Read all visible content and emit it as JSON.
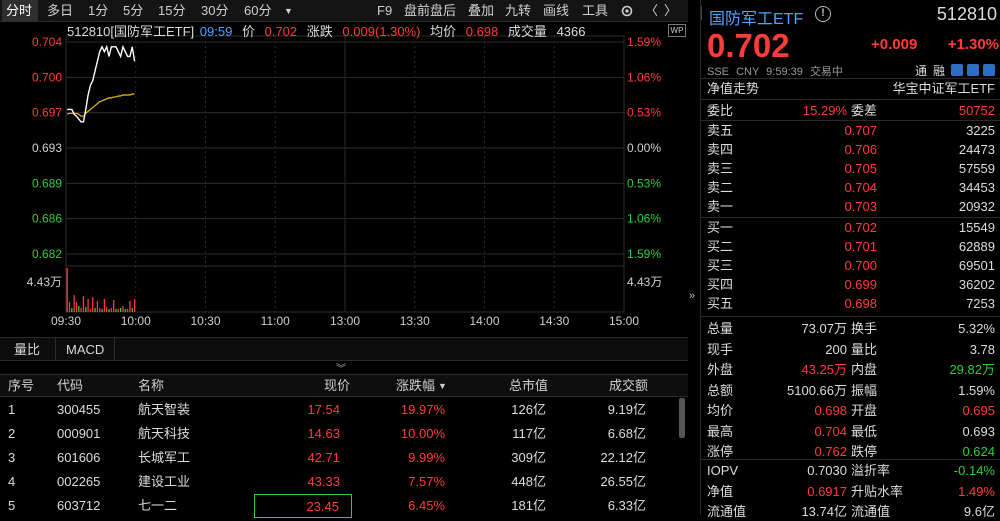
{
  "toolbar": {
    "items": [
      "分时",
      "多日",
      "1分",
      "5分",
      "15分",
      "30分",
      "60分",
      "F9",
      "盘前盘后",
      "叠加",
      "九转",
      "画线",
      "工具"
    ],
    "active": "分时"
  },
  "chart_header": {
    "code_name": "512810[国防军工ETF]",
    "time": "09:59",
    "price_label": "价",
    "price": "0.702",
    "change_label": "涨跌",
    "change": "0.009(1.30%)",
    "avg_label": "均价",
    "avg": "0.698",
    "vol_label": "成交量",
    "vol": "4366"
  },
  "chart_data": {
    "type": "line",
    "y_ticks_left": [
      "0.704",
      "0.700",
      "0.697",
      "0.693",
      "0.689",
      "0.686",
      "0.682"
    ],
    "y_ticks_right": [
      "1.59%",
      "1.06%",
      "0.53%",
      "0.00%",
      "0.53%",
      "1.06%",
      "1.59%"
    ],
    "ylim": [
      0.682,
      0.704
    ],
    "prev_close": 0.693,
    "x_ticks": [
      "09:30",
      "10:00",
      "10:30",
      "11:00",
      "13:00",
      "13:30",
      "14:00",
      "14:30",
      "15:00"
    ],
    "price_series": {
      "values": [
        0.697,
        0.697,
        0.697,
        0.6965,
        0.6963,
        0.696,
        0.6957,
        0.6957,
        0.697,
        0.6985,
        0.6995,
        0.7,
        0.701,
        0.702,
        0.703,
        0.7035,
        0.703,
        0.7035,
        0.7025,
        0.7035,
        0.7035,
        0.7035,
        0.703,
        0.7025,
        0.7035,
        0.703,
        0.7025,
        0.7025,
        0.7035,
        0.702
      ]
    },
    "avg_series": {
      "values": [
        0.6965,
        0.6966,
        0.6966,
        0.6966,
        0.6966,
        0.6965,
        0.6963,
        0.6963,
        0.6966,
        0.6968,
        0.697,
        0.6972,
        0.6974,
        0.6976,
        0.6978,
        0.6979,
        0.698,
        0.6981,
        0.6982,
        0.6982,
        0.6983,
        0.6983,
        0.6984,
        0.6984,
        0.6985,
        0.6985,
        0.6985,
        0.6985,
        0.6986,
        0.6986
      ]
    },
    "volume_label": "4.43万",
    "volume": {
      "values": [
        4.43,
        1.0,
        0.4,
        1.7,
        1.0,
        0.6,
        0.4,
        1.6,
        0.5,
        1.3,
        0.3,
        1.5,
        0.4,
        1.1,
        0.4,
        0.3,
        1.3,
        0.5,
        0.3,
        0.4,
        1.2,
        0.3,
        0.3,
        0.4,
        0.6,
        0.3,
        0.3,
        1.1,
        0.4,
        1.3
      ]
    },
    "volume_up": [
      true,
      true,
      false,
      true,
      true,
      false,
      true,
      true,
      false,
      true,
      true,
      true,
      false,
      true,
      true,
      false,
      true,
      true,
      false,
      true,
      true,
      false,
      true,
      false,
      true,
      false,
      true,
      true,
      false,
      true
    ]
  },
  "indicator_tabs": [
    "量比",
    "MACD"
  ],
  "table": {
    "headers": [
      "序号",
      "代码",
      "名称",
      "现价",
      "涨跌幅",
      "总市值",
      "成交额"
    ],
    "sort_icon": "▼",
    "rows": [
      [
        "1",
        "300455",
        "航天智装",
        "17.54",
        "19.97%",
        "126亿",
        "9.19亿"
      ],
      [
        "2",
        "000901",
        "航天科技",
        "14.63",
        "10.00%",
        "117亿",
        "6.68亿"
      ],
      [
        "3",
        "601606",
        "长城军工",
        "42.71",
        "9.99%",
        "309亿",
        "22.12亿"
      ],
      [
        "4",
        "002265",
        "建设工业",
        "43.33",
        "7.57%",
        "448亿",
        "26.55亿"
      ],
      [
        "5",
        "603712",
        "七一二",
        "23.45",
        "6.45%",
        "181亿",
        "6.33亿"
      ]
    ]
  },
  "quote": {
    "name": "国防军工ETF",
    "code": "512810",
    "price": "0.702",
    "change": "+0.009",
    "pct": "+1.30%",
    "exchange": "SSE",
    "currency": "CNY",
    "time": "9:59:39",
    "status": "交易中",
    "badges": [
      "通",
      "融"
    ],
    "nav_trend": "净值走势",
    "tracking": "华宝中证军工ETF",
    "weibi_label": "委比",
    "weibi": "15.29%",
    "weicha_label": "委差",
    "weicha": "50752"
  },
  "asks": [
    {
      "label": "卖五",
      "price": "0.707",
      "vol": "3225"
    },
    {
      "label": "卖四",
      "price": "0.706",
      "vol": "24473"
    },
    {
      "label": "卖三",
      "price": "0.705",
      "vol": "57559"
    },
    {
      "label": "卖二",
      "price": "0.704",
      "vol": "34453"
    },
    {
      "label": "卖一",
      "price": "0.703",
      "vol": "20932"
    }
  ],
  "bids": [
    {
      "label": "买一",
      "price": "0.702",
      "vol": "15549"
    },
    {
      "label": "买二",
      "price": "0.701",
      "vol": "62889"
    },
    {
      "label": "买三",
      "price": "0.700",
      "vol": "69501"
    },
    {
      "label": "买四",
      "price": "0.699",
      "vol": "36202"
    },
    {
      "label": "买五",
      "price": "0.698",
      "vol": "7253"
    }
  ],
  "stats": [
    {
      "l1": "总量",
      "v1": "73.07万",
      "c1": "wht",
      "l2": "换手",
      "v2": "5.32%",
      "c2": "wht"
    },
    {
      "l1": "现手",
      "v1": "200",
      "c1": "wht",
      "l2": "量比",
      "v2": "3.78",
      "c2": "wht"
    },
    {
      "l1": "外盘",
      "v1": "43.25万",
      "c1": "red",
      "l2": "内盘",
      "v2": "29.82万",
      "c2": "grn"
    },
    {
      "l1": "总额",
      "v1": "5100.66万",
      "c1": "wht",
      "l2": "振幅",
      "v2": "1.59%",
      "c2": "wht"
    },
    {
      "l1": "均价",
      "v1": "0.698",
      "c1": "red",
      "l2": "开盘",
      "v2": "0.695",
      "c2": "red"
    },
    {
      "l1": "最高",
      "v1": "0.704",
      "c1": "red",
      "l2": "最低",
      "v2": "0.693",
      "c2": "wht"
    },
    {
      "l1": "涨停",
      "v1": "0.762",
      "c1": "red",
      "l2": "跌停",
      "v2": "0.624",
      "c2": "grn"
    }
  ],
  "stats2": [
    {
      "l1": "IOPV",
      "v1": "0.7030",
      "c1": "wht",
      "l2": "溢折率",
      "v2": "-0.14%",
      "c2": "grn"
    },
    {
      "l1": "净值",
      "v1": "0.6917",
      "c1": "red",
      "l2": "升贴水率",
      "v2": "1.49%",
      "c2": "red"
    },
    {
      "l1": "流通值",
      "v1": "13.74亿",
      "c1": "wht",
      "l2": "流通值",
      "v2": "9.6亿",
      "c2": "wht"
    }
  ],
  "colors": {
    "up": "#ff3b3b",
    "down": "#2ecc40",
    "price_line": "#ffffff",
    "avg_line": "#e8c000",
    "grid": "#2b2b2b"
  }
}
